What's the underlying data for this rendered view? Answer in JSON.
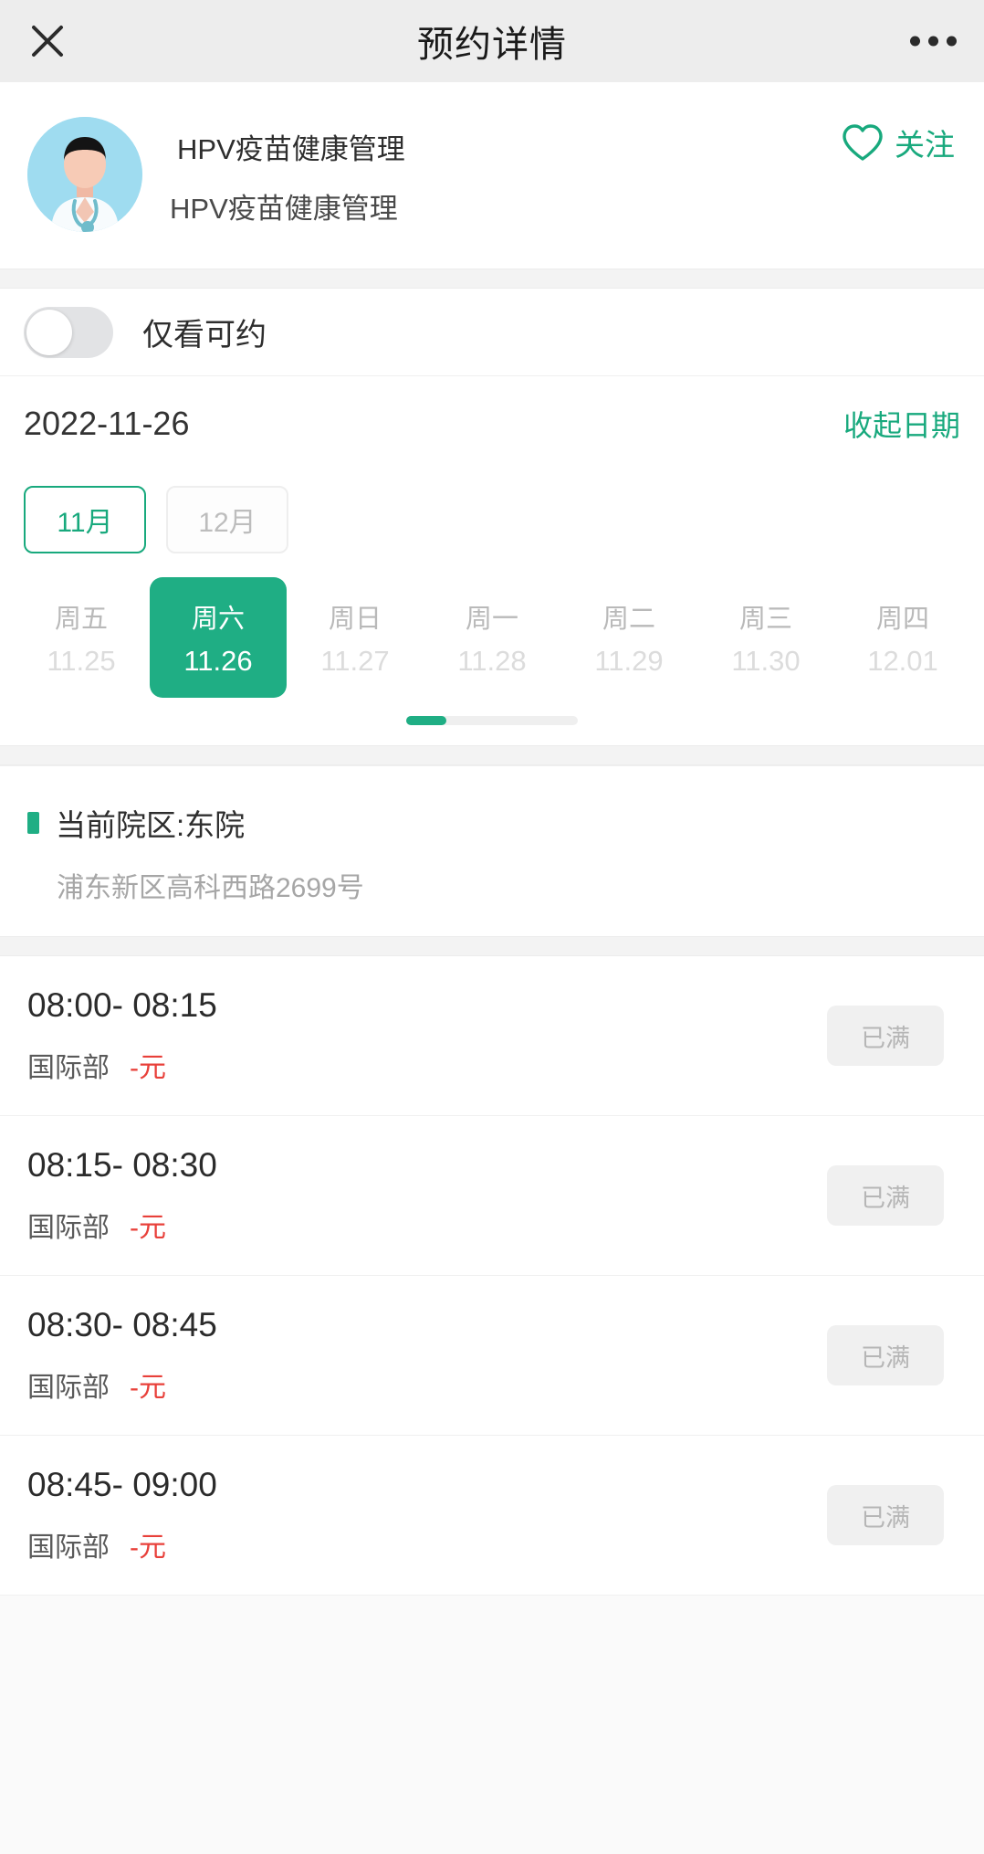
{
  "navbar": {
    "title": "预约详情",
    "close_icon": "close-icon",
    "more_icon": "more-dots-icon"
  },
  "org": {
    "avatar_icon": "doctor-avatar",
    "name": "HPV疫苗健康管理",
    "sub_name": "HPV疫苗健康管理",
    "follow_label": "关注",
    "follow_icon": "heart-icon",
    "accent_color": "#18a97d"
  },
  "filter": {
    "only_available_label": "仅看可约",
    "toggle_on": false
  },
  "date_header": {
    "selected_date": "2022-11-26",
    "collapse_label": "收起日期"
  },
  "months": [
    {
      "label": "11月",
      "active": true
    },
    {
      "label": "12月",
      "active": false
    }
  ],
  "days": [
    {
      "dow": "周五",
      "date": "11.25",
      "selected": false
    },
    {
      "dow": "周六",
      "date": "11.26",
      "selected": true
    },
    {
      "dow": "周日",
      "date": "11.27",
      "selected": false
    },
    {
      "dow": "周一",
      "date": "11.28",
      "selected": false
    },
    {
      "dow": "周二",
      "date": "11.29",
      "selected": false
    },
    {
      "dow": "周三",
      "date": "11.30",
      "selected": false
    },
    {
      "dow": "周四",
      "date": "12.01",
      "selected": false
    }
  ],
  "campus": {
    "title": "当前院区:东院",
    "address": "浦东新区高科西路2699号"
  },
  "slots": [
    {
      "time": "08:00- 08:15",
      "dept": "国际部",
      "price": "-元",
      "badge": "已满"
    },
    {
      "time": "08:15- 08:30",
      "dept": "国际部",
      "price": "-元",
      "badge": "已满"
    },
    {
      "time": "08:30- 08:45",
      "dept": "国际部",
      "price": "-元",
      "badge": "已满"
    },
    {
      "time": "08:45- 09:00",
      "dept": "国际部",
      "price": "-元",
      "badge": "已满"
    }
  ],
  "colors": {
    "brand_green": "#1fae84",
    "link_green": "#18a97d",
    "price_red": "#e8403a",
    "navbar_bg": "#ededed"
  }
}
